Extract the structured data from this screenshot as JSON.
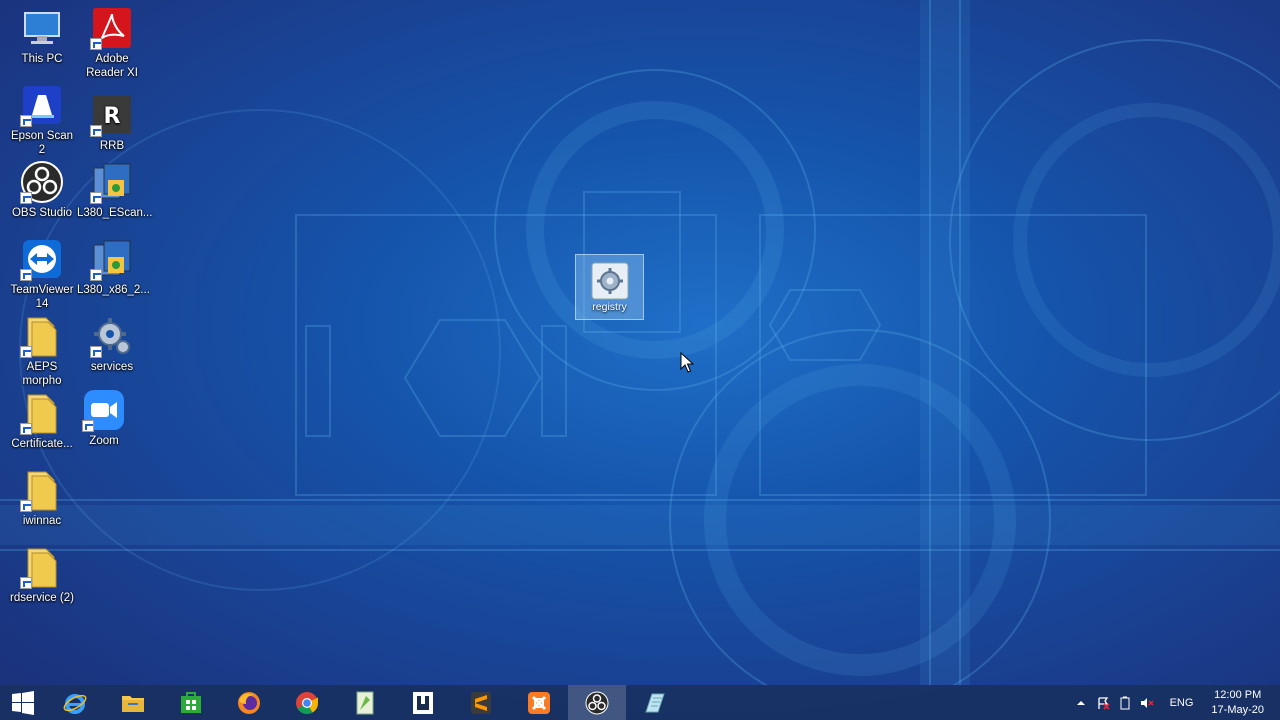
{
  "desktop": {
    "icons": [
      {
        "label": "This PC",
        "icon": "this-pc-icon"
      },
      {
        "label": "Adobe\nReader XI",
        "icon": "adobe-reader-icon"
      },
      {
        "label": "Epson Scan 2",
        "icon": "epson-scan-icon"
      },
      {
        "label": "RRB",
        "icon": "rrb-icon",
        "glyph": "R"
      },
      {
        "label": "OBS Studio",
        "icon": "obs-studio-icon"
      },
      {
        "label": "L380_EScan...",
        "icon": "installer-icon"
      },
      {
        "label": "TeamViewer\n14",
        "icon": "teamviewer-icon"
      },
      {
        "label": "L380_x86_2...",
        "icon": "installer-icon"
      },
      {
        "label": "AEPS\nmorpho",
        "icon": "folder-icon"
      },
      {
        "label": "services",
        "icon": "services-gear-icon"
      },
      {
        "label": "Certificate...",
        "icon": "folder-icon"
      },
      {
        "label": "Zoom",
        "icon": "zoom-icon"
      },
      {
        "label": "iwinnac",
        "icon": "folder-icon"
      },
      {
        "label": "rdservice (2)",
        "icon": "folder-icon"
      }
    ],
    "selected_file": {
      "label": "registry",
      "icon": "registry-file-icon"
    }
  },
  "taskbar": {
    "apps": [
      {
        "name": "start",
        "icon": "windows-logo-icon"
      },
      {
        "name": "internet-explorer",
        "icon": "internet-explorer-icon"
      },
      {
        "name": "file-explorer",
        "icon": "file-explorer-icon"
      },
      {
        "name": "store",
        "icon": "store-icon"
      },
      {
        "name": "firefox",
        "icon": "firefox-icon"
      },
      {
        "name": "chrome",
        "icon": "chrome-icon"
      },
      {
        "name": "notepad-plus",
        "icon": "notepad-icon"
      },
      {
        "name": "app-frame",
        "icon": "frame-icon"
      },
      {
        "name": "sublime-text",
        "icon": "sublime-icon"
      },
      {
        "name": "xampp",
        "icon": "xampp-icon"
      },
      {
        "name": "obs",
        "icon": "obs-icon"
      },
      {
        "name": "notepad",
        "icon": "notepad-blue-icon"
      }
    ],
    "tray": {
      "language": "ENG",
      "time": "12:00 PM",
      "date": "17-May-20"
    }
  },
  "colors": {
    "desktop_bg": "#1554ab",
    "taskbar_bg": "#183060",
    "selection": "#8cbef0"
  }
}
